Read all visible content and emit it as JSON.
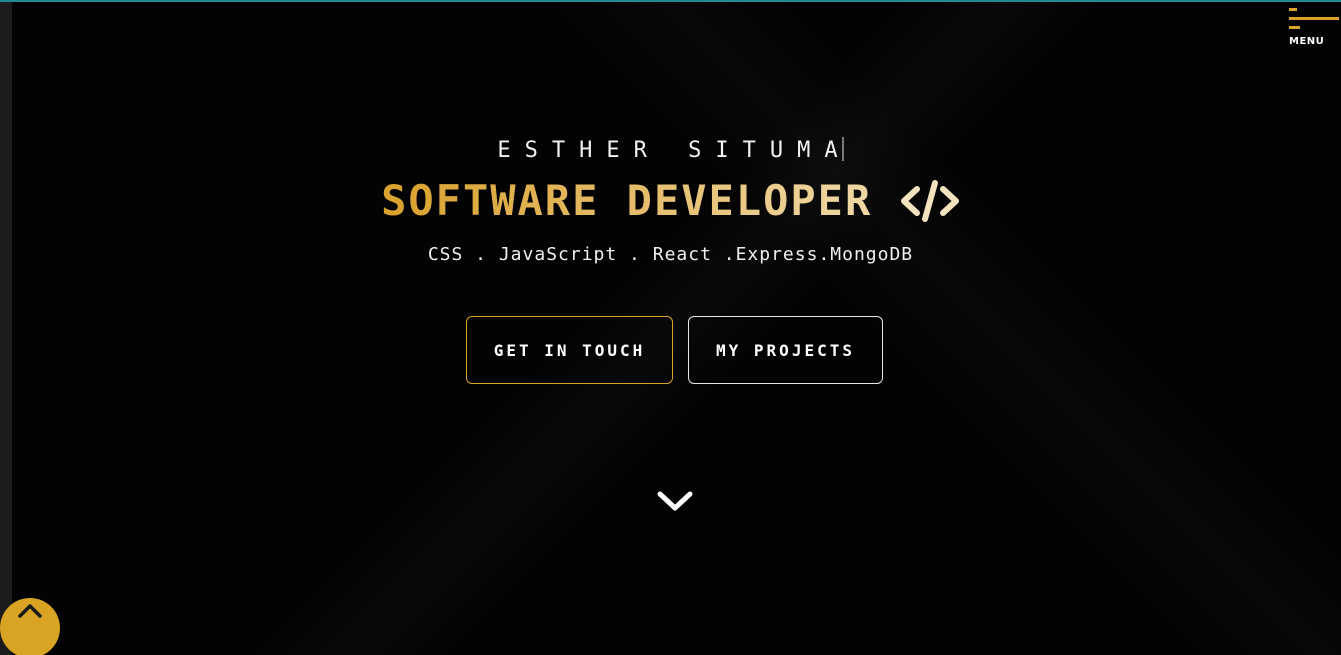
{
  "menu": {
    "label": "MENU",
    "icon": "hamburger-icon",
    "accent": "#d9a32a"
  },
  "hero": {
    "name": "ESTHER SITUMA",
    "title": "SOFTWARE DEVELOPER",
    "title_icon": "code-icon",
    "stack": "CSS . JavaScript . React .Express.MongoDB"
  },
  "buttons": {
    "touch": "GET IN TOUCH",
    "projects": "MY PROJECTS"
  },
  "icons": {
    "scroll_down": "chevron-down-icon",
    "back_to_top": "chevron-up-icon"
  },
  "colors": {
    "accent": "#d9a12c",
    "background": "#030303",
    "text": "#f0f0f0"
  }
}
